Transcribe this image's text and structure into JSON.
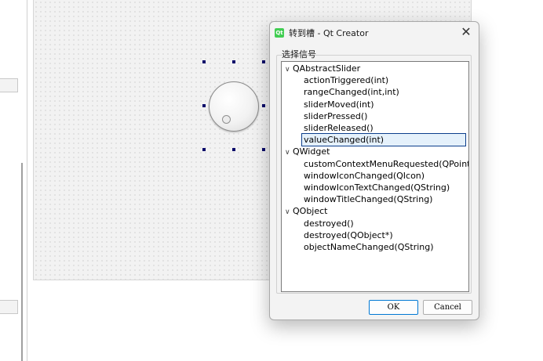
{
  "dialog": {
    "title": "转到槽 - Qt Creator",
    "app_icon": "qt-creator-icon",
    "close_glyph": "✕",
    "group_label": "选择信号",
    "ok_label": "OK",
    "cancel_label": "Cancel"
  },
  "tree": {
    "groups": [
      {
        "label": "QAbstractSlider",
        "expanded": true,
        "items": [
          "actionTriggered(int)",
          "rangeChanged(int,int)",
          "sliderMoved(int)",
          "sliderPressed()",
          "sliderReleased()",
          "valueChanged(int)"
        ]
      },
      {
        "label": "QWidget",
        "expanded": true,
        "items": [
          "customContextMenuRequested(QPoint)",
          "windowIconChanged(QIcon)",
          "windowIconTextChanged(QString)",
          "windowTitleChanged(QString)"
        ]
      },
      {
        "label": "QObject",
        "expanded": true,
        "items": [
          "destroyed()",
          "destroyed(QObject*)",
          "objectNameChanged(QString)"
        ]
      }
    ],
    "selected": "valueChanged(int)"
  },
  "colors": {
    "selection_border": "#0c3e8c",
    "selection_fill": "#e5f1fb",
    "qt_green": "#41cd52"
  }
}
